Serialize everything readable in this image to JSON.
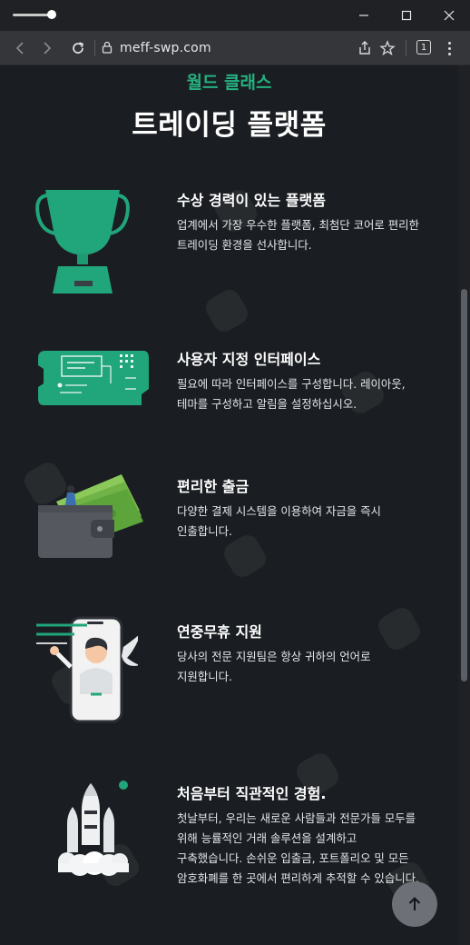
{
  "browser": {
    "url": "meff-swp.com",
    "tab_count": "1",
    "icons": [
      "slider-icon",
      "minimize-icon",
      "maximize-icon",
      "close-icon",
      "back-arrow-icon",
      "forward-arrow-icon",
      "reload-icon",
      "lock-icon",
      "share-icon",
      "bookmark-icon",
      "tab-count-icon",
      "menu-dots-icon"
    ]
  },
  "hero": {
    "eyebrow": "월드 클래스",
    "title": "트레이딩 플랫폼"
  },
  "features": [
    {
      "title": "수상 경력이 있는 플랫폼",
      "desc": "업계에서 가장 우수한 플랫폼, 최첨단 코어로 편리한 트레이딩 환경을 선사합니다.",
      "icon": "trophy-icon"
    },
    {
      "title": "사용자 지정 인터페이스",
      "desc": "필요에 따라 인터페이스를 구성합니다. 레이아웃, 테마를 구성하고 알림을 설정하십시오.",
      "icon": "interface-panel-icon"
    },
    {
      "title": "편리한 출금",
      "desc": "다양한 결제 시스템을 이용하여 자금을 즉시 인출합니다.",
      "icon": "wallet-cash-icon"
    },
    {
      "title": "연중무휴 지원",
      "desc": "당사의 전문 지원팀은 항상 귀하의 언어로 지원합니다.",
      "icon": "support-phone-icon"
    },
    {
      "title": "처음부터 직관적인 경험.",
      "desc": "첫날부터, 우리는 새로운 사람들과 전문가들 모두를 위해 능률적인 거래 솔루션을 설계하고 구축했습니다. 손쉬운 입출금, 포트폴리오 및 모든 암호화폐를 한 곳에서 편리하게 추적할 수 있습니다.",
      "icon": "rocket-icon"
    }
  ],
  "colors": {
    "accent": "#25b07f",
    "background": "#1a1d21",
    "chrome": "#35363a"
  }
}
